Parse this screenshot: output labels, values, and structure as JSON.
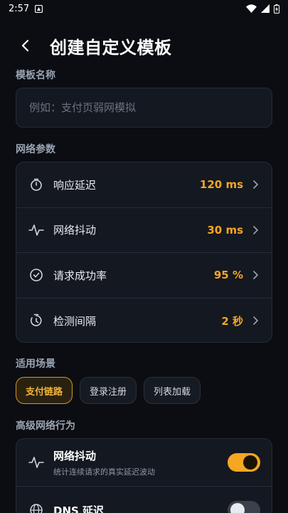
{
  "status_bar": {
    "time": "2:57"
  },
  "header": {
    "title": "创建自定义模板"
  },
  "template_name": {
    "section_title": "模板名称",
    "placeholder": "例如：支付页弱网模拟",
    "value": ""
  },
  "network_params": {
    "section_title": "网络参数",
    "rows": [
      {
        "label": "响应延迟",
        "value": "120 ms",
        "icon": "timer-icon"
      },
      {
        "label": "网络抖动",
        "value": "30 ms",
        "icon": "pulse-icon"
      },
      {
        "label": "请求成功率",
        "value": "95 %",
        "icon": "check-circle-icon"
      },
      {
        "label": "检测间隔",
        "value": "2 秒",
        "icon": "interval-timer-icon"
      }
    ]
  },
  "scenarios": {
    "section_title": "适用场景",
    "chips": [
      {
        "label": "支付链路",
        "active": true
      },
      {
        "label": "登录注册",
        "active": false
      },
      {
        "label": "列表加载",
        "active": false
      }
    ]
  },
  "advanced": {
    "section_title": "高级网络行为",
    "rows": [
      {
        "title": "网络抖动",
        "subtitle": "统计连续请求的真实延迟波动",
        "enabled": true,
        "icon": "pulse-icon"
      },
      {
        "title": "DNS 延迟",
        "subtitle": "",
        "enabled": false,
        "icon": "globe-icon"
      }
    ]
  },
  "colors": {
    "accent": "#f5a623",
    "background": "#0b0d12",
    "card": "#141820"
  }
}
